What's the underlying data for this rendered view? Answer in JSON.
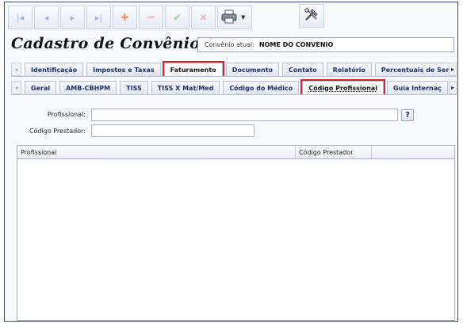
{
  "toolbar": {
    "first_icon": "|◂",
    "prev_icon": "◂",
    "next_icon": "▸",
    "last_icon": "▸|",
    "add_icon": "+",
    "remove_icon": "−",
    "confirm_icon": "✔",
    "cancel_icon": "✕",
    "print_icon": "🖨",
    "tools_icon": "⚒"
  },
  "header": {
    "title": "Cadastro de Convênios",
    "convenio_label": "Convênio atual:",
    "convenio_value": "NOME DO CONVENIO"
  },
  "tabs_main": [
    {
      "label": "Identificação"
    },
    {
      "label": "Impostos e Taxas"
    },
    {
      "label": "Faturamento"
    },
    {
      "label": "Documento"
    },
    {
      "label": "Contato"
    },
    {
      "label": "Relatório"
    },
    {
      "label": "Percentuais de Serv"
    }
  ],
  "tabs_sub": [
    {
      "label": "Geral"
    },
    {
      "label": "AMB-CBHPM"
    },
    {
      "label": "TISS"
    },
    {
      "label": "TISS X Mat/Med"
    },
    {
      "label": "Código do Médico"
    },
    {
      "label": "Código Profissional"
    },
    {
      "label": "Guia Internaç"
    }
  ],
  "form": {
    "profissional_label": "Profissional:",
    "profissional_value": "",
    "codigo_prestador_label": "Código Prestador:",
    "codigo_prestador_value": "",
    "help_label": "?"
  },
  "grid": {
    "columns": [
      "Profissional",
      "Código Prestador",
      ""
    ],
    "rows": []
  },
  "colors": {
    "accent": "#1a2e6b",
    "highlight": "#d6202b",
    "frame": "#3b4a75"
  }
}
